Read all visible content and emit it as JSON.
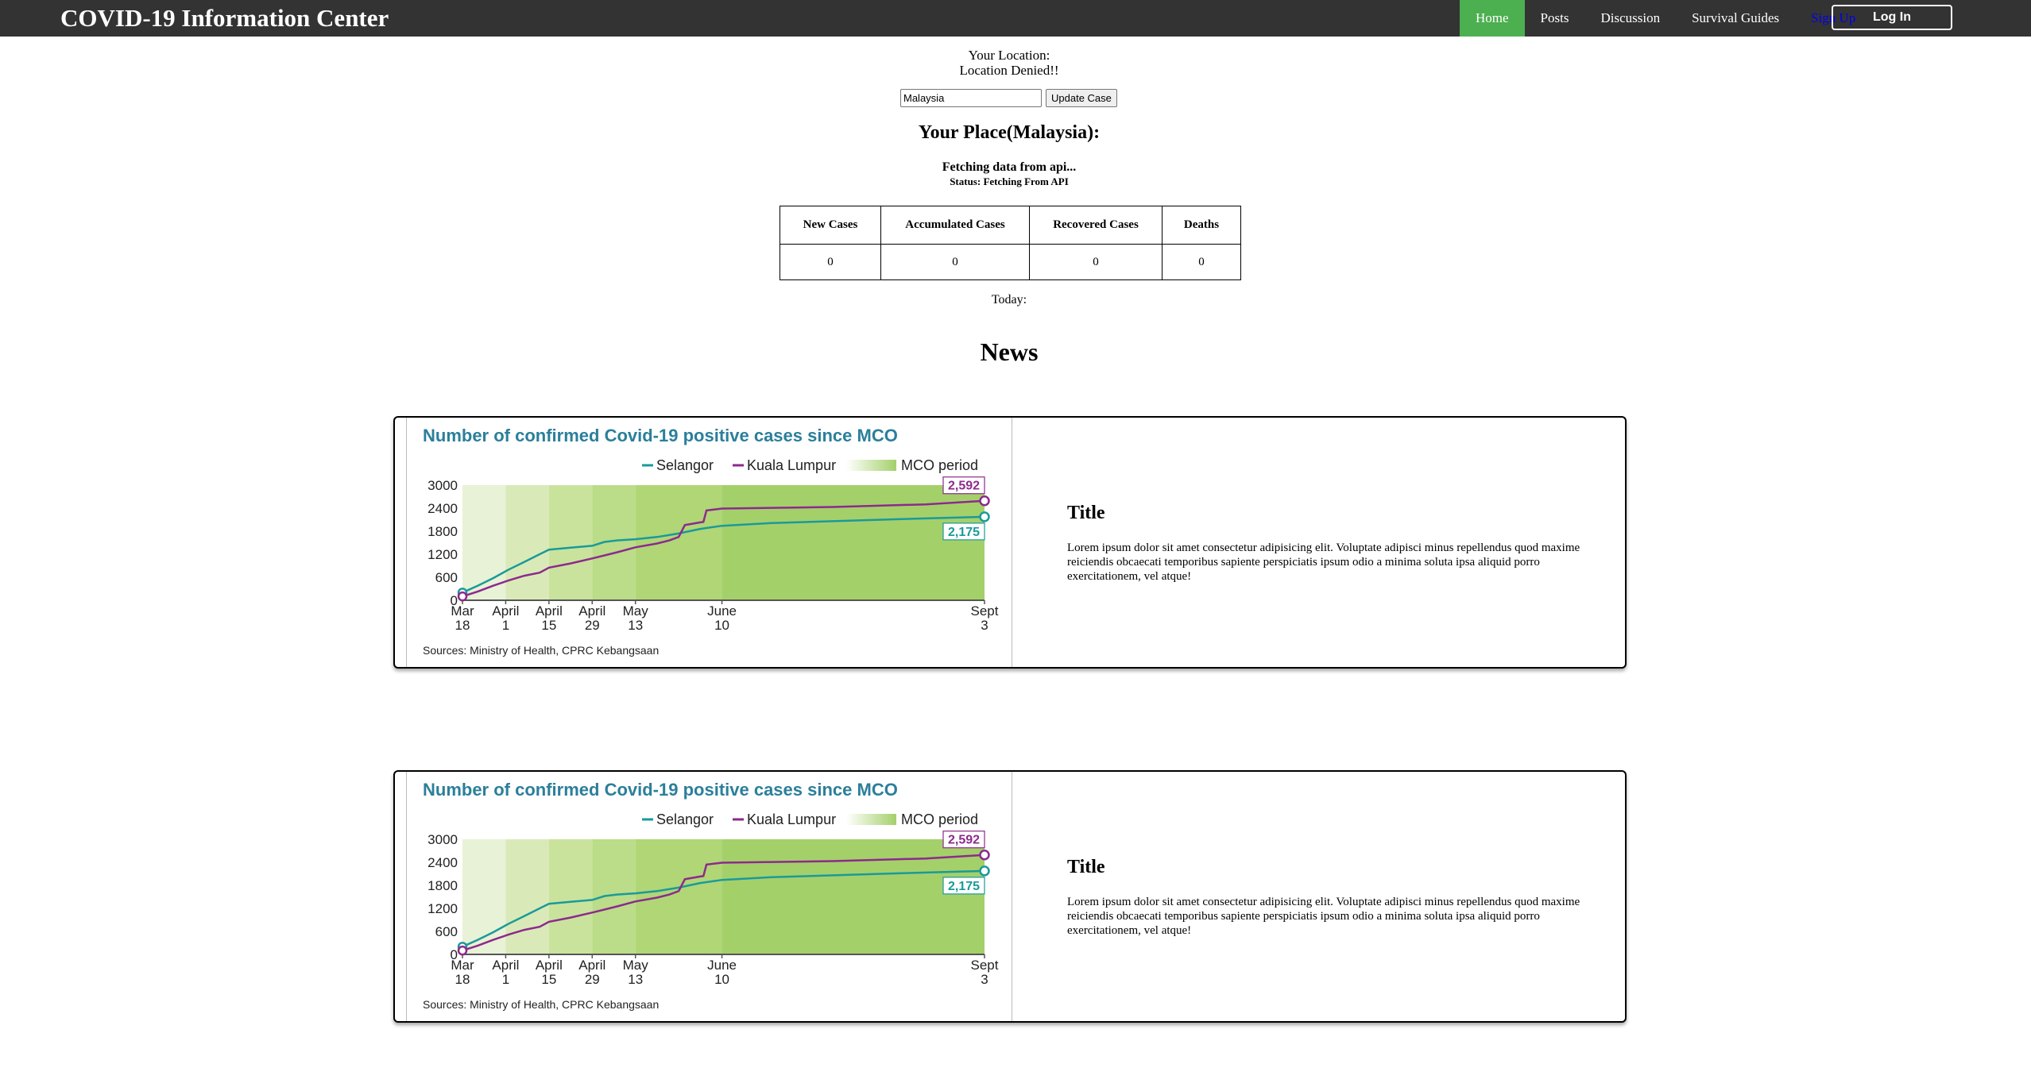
{
  "navbar": {
    "brand": "COVID-19 Information Center",
    "items": [
      {
        "label": "Home",
        "active": true
      },
      {
        "label": "Posts"
      },
      {
        "label": "Discussion"
      },
      {
        "label": "Survival Guides"
      },
      {
        "label": "Sign Up"
      }
    ],
    "login_label": "Log In",
    "colors": {
      "bar": "#333333",
      "active": "#4CAF50",
      "signup": "#0000ee"
    }
  },
  "location": {
    "label": "Your Location:",
    "value": "Location Denied!!",
    "input_value": "Malaysia",
    "update_label": "Update Case"
  },
  "place": {
    "title": "Your Place(Malaysia):",
    "fetching": "Fetching data from api...",
    "status": "Status: Fetching From API"
  },
  "stats": {
    "headers": [
      "New Cases",
      "Accumulated Cases",
      "Recovered Cases",
      "Deaths"
    ],
    "values": [
      "0",
      "0",
      "0",
      "0"
    ],
    "today_label": "Today:"
  },
  "news": {
    "heading": "News",
    "cards": [
      {
        "title": "Title",
        "text": "Lorem ipsum dolor sit amet consectetur adipisicing elit. Voluptate adipisci minus repellendus quod maxime reiciendis obcaecati temporibus sapiente perspiciatis ipsum odio a minima soluta ipsa aliquid porro exercitationem, vel atque!"
      },
      {
        "title": "Title",
        "text": "Lorem ipsum dolor sit amet consectetur adipisicing elit. Voluptate adipisci minus repellendus quod maxime reiciendis obcaecati temporibus sapiente perspiciatis ipsum odio a minima soluta ipsa aliquid porro exercitationem, vel atque!"
      }
    ]
  },
  "chart_data": {
    "type": "line",
    "title": "Number of confirmed Covid-19 positive cases since MCO",
    "source": "Sources: Ministry of Health, CPRC Kebangsaan",
    "mco_label": "MCO period",
    "x_ticks": [
      {
        "day": 0,
        "line1": "Mar",
        "line2": "18"
      },
      {
        "day": 14,
        "line1": "April",
        "line2": "1"
      },
      {
        "day": 28,
        "line1": "April",
        "line2": "15"
      },
      {
        "day": 42,
        "line1": "April",
        "line2": "29"
      },
      {
        "day": 56,
        "line1": "May",
        "line2": "13"
      },
      {
        "day": 84,
        "line1": "June",
        "line2": "10"
      },
      {
        "day": 169,
        "line1": "Sept",
        "line2": "3"
      }
    ],
    "xlim": [
      0,
      169
    ],
    "ylim": [
      0,
      3000
    ],
    "y_ticks": [
      0,
      600,
      1200,
      1800,
      2400,
      3000
    ],
    "mco_phases": [
      {
        "from": 0,
        "to": 14,
        "color": "#e8f2d6"
      },
      {
        "from": 14,
        "to": 28,
        "color": "#d9eab8"
      },
      {
        "from": 28,
        "to": 42,
        "color": "#c9e39d"
      },
      {
        "from": 42,
        "to": 56,
        "color": "#bbdc88"
      },
      {
        "from": 56,
        "to": 84,
        "color": "#b0d676"
      },
      {
        "from": 84,
        "to": 169,
        "color": "#a4d06a"
      }
    ],
    "series": [
      {
        "name": "Selangor",
        "color": "#1a9a9a",
        "end_label": "2,175",
        "points": [
          [
            0,
            200
          ],
          [
            5,
            380
          ],
          [
            10,
            580
          ],
          [
            15,
            800
          ],
          [
            20,
            1000
          ],
          [
            25,
            1200
          ],
          [
            28,
            1320
          ],
          [
            35,
            1370
          ],
          [
            42,
            1420
          ],
          [
            46,
            1520
          ],
          [
            50,
            1560
          ],
          [
            56,
            1590
          ],
          [
            63,
            1650
          ],
          [
            70,
            1740
          ],
          [
            77,
            1860
          ],
          [
            84,
            1940
          ],
          [
            100,
            2010
          ],
          [
            120,
            2060
          ],
          [
            140,
            2110
          ],
          [
            169,
            2175
          ]
        ]
      },
      {
        "name": "Kuala Lumpur",
        "color": "#8c2a8c",
        "end_label": "2,592",
        "points": [
          [
            0,
            100
          ],
          [
            5,
            230
          ],
          [
            10,
            380
          ],
          [
            15,
            520
          ],
          [
            20,
            640
          ],
          [
            25,
            720
          ],
          [
            28,
            850
          ],
          [
            35,
            960
          ],
          [
            42,
            1090
          ],
          [
            50,
            1250
          ],
          [
            56,
            1380
          ],
          [
            63,
            1480
          ],
          [
            67,
            1560
          ],
          [
            70,
            1650
          ],
          [
            72,
            1960
          ],
          [
            77,
            2030
          ],
          [
            78,
            2040
          ],
          [
            79,
            2340
          ],
          [
            84,
            2390
          ],
          [
            120,
            2430
          ],
          [
            150,
            2500
          ],
          [
            169,
            2592
          ]
        ]
      }
    ]
  }
}
